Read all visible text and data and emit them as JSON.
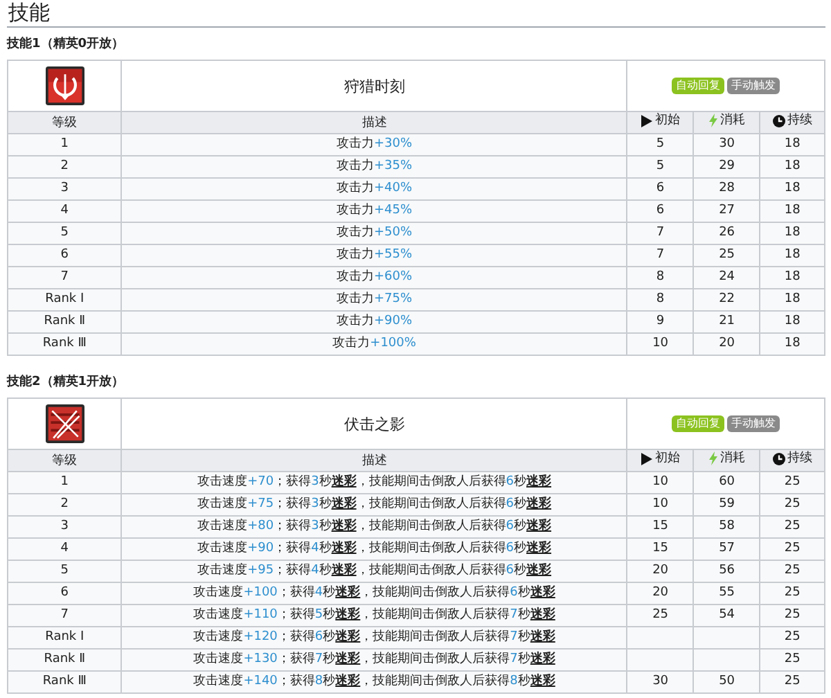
{
  "title": "技能",
  "skills": [
    {
      "heading": "技能1（精英0开放）",
      "kind": "circle-arrow",
      "name": "狩猎时刻",
      "tags": [
        {
          "label": "自动回复",
          "color": "#8cc21f"
        },
        {
          "label": "手动触发",
          "color": "#8a8a8a"
        }
      ],
      "columns": {
        "level": "等级",
        "description": "描述",
        "initial": "初始",
        "cost": "消耗",
        "duration": "持续"
      },
      "rows": [
        {
          "level": "1",
          "description": [
            {
              "kind": "plain",
              "text": "攻击力"
            },
            {
              "kind": "value",
              "text": "+30%"
            }
          ],
          "initial": "5",
          "cost": "30",
          "duration": "18"
        },
        {
          "level": "2",
          "description": [
            {
              "kind": "plain",
              "text": "攻击力"
            },
            {
              "kind": "value",
              "text": "+35%"
            }
          ],
          "initial": "5",
          "cost": "29",
          "duration": "18"
        },
        {
          "level": "3",
          "description": [
            {
              "kind": "plain",
              "text": "攻击力"
            },
            {
              "kind": "value",
              "text": "+40%"
            }
          ],
          "initial": "6",
          "cost": "28",
          "duration": "18"
        },
        {
          "level": "4",
          "description": [
            {
              "kind": "plain",
              "text": "攻击力"
            },
            {
              "kind": "value",
              "text": "+45%"
            }
          ],
          "initial": "6",
          "cost": "27",
          "duration": "18"
        },
        {
          "level": "5",
          "description": [
            {
              "kind": "plain",
              "text": "攻击力"
            },
            {
              "kind": "value",
              "text": "+50%"
            }
          ],
          "initial": "7",
          "cost": "26",
          "duration": "18"
        },
        {
          "level": "6",
          "description": [
            {
              "kind": "plain",
              "text": "攻击力"
            },
            {
              "kind": "value",
              "text": "+55%"
            }
          ],
          "initial": "7",
          "cost": "25",
          "duration": "18"
        },
        {
          "level": "7",
          "description": [
            {
              "kind": "plain",
              "text": "攻击力"
            },
            {
              "kind": "value",
              "text": "+60%"
            }
          ],
          "initial": "8",
          "cost": "24",
          "duration": "18"
        },
        {
          "level": "Rank Ⅰ",
          "description": [
            {
              "kind": "plain",
              "text": "攻击力"
            },
            {
              "kind": "value",
              "text": "+75%"
            }
          ],
          "initial": "8",
          "cost": "22",
          "duration": "18"
        },
        {
          "level": "Rank Ⅱ",
          "description": [
            {
              "kind": "plain",
              "text": "攻击力"
            },
            {
              "kind": "value",
              "text": "+90%"
            }
          ],
          "initial": "9",
          "cost": "21",
          "duration": "18"
        },
        {
          "level": "Rank Ⅲ",
          "description": [
            {
              "kind": "plain",
              "text": "攻击力"
            },
            {
              "kind": "value",
              "text": "+100%"
            }
          ],
          "initial": "10",
          "cost": "20",
          "duration": "18"
        }
      ]
    },
    {
      "heading": "技能2（精英1开放）",
      "kind": "crossed-arrows",
      "name": "伏击之影",
      "tags": [
        {
          "label": "自动回复",
          "color": "#8cc21f"
        },
        {
          "label": "手动触发",
          "color": "#8a8a8a"
        }
      ],
      "columns": {
        "level": "等级",
        "description": "描述",
        "initial": "初始",
        "cost": "消耗",
        "duration": "持续"
      },
      "rows": [
        {
          "level": "1",
          "description": [
            {
              "kind": "plain",
              "text": "攻击速度"
            },
            {
              "kind": "value",
              "text": "+70"
            },
            {
              "kind": "plain",
              "text": "；获得"
            },
            {
              "kind": "value",
              "text": "3"
            },
            {
              "kind": "plain",
              "text": "秒"
            },
            {
              "kind": "term",
              "text": "迷彩"
            },
            {
              "kind": "plain",
              "text": "，技能期间击倒敌人后获得"
            },
            {
              "kind": "value",
              "text": "6"
            },
            {
              "kind": "plain",
              "text": "秒"
            },
            {
              "kind": "term",
              "text": "迷彩"
            }
          ],
          "initial": "10",
          "cost": "60",
          "duration": "25"
        },
        {
          "level": "2",
          "description": [
            {
              "kind": "plain",
              "text": "攻击速度"
            },
            {
              "kind": "value",
              "text": "+75"
            },
            {
              "kind": "plain",
              "text": "；获得"
            },
            {
              "kind": "value",
              "text": "3"
            },
            {
              "kind": "plain",
              "text": "秒"
            },
            {
              "kind": "term",
              "text": "迷彩"
            },
            {
              "kind": "plain",
              "text": "，技能期间击倒敌人后获得"
            },
            {
              "kind": "value",
              "text": "6"
            },
            {
              "kind": "plain",
              "text": "秒"
            },
            {
              "kind": "term",
              "text": "迷彩"
            }
          ],
          "initial": "10",
          "cost": "59",
          "duration": "25"
        },
        {
          "level": "3",
          "description": [
            {
              "kind": "plain",
              "text": "攻击速度"
            },
            {
              "kind": "value",
              "text": "+80"
            },
            {
              "kind": "plain",
              "text": "；获得"
            },
            {
              "kind": "value",
              "text": "3"
            },
            {
              "kind": "plain",
              "text": "秒"
            },
            {
              "kind": "term",
              "text": "迷彩"
            },
            {
              "kind": "plain",
              "text": "，技能期间击倒敌人后获得"
            },
            {
              "kind": "value",
              "text": "6"
            },
            {
              "kind": "plain",
              "text": "秒"
            },
            {
              "kind": "term",
              "text": "迷彩"
            }
          ],
          "initial": "15",
          "cost": "58",
          "duration": "25"
        },
        {
          "level": "4",
          "description": [
            {
              "kind": "plain",
              "text": "攻击速度"
            },
            {
              "kind": "value",
              "text": "+90"
            },
            {
              "kind": "plain",
              "text": "；获得"
            },
            {
              "kind": "value",
              "text": "4"
            },
            {
              "kind": "plain",
              "text": "秒"
            },
            {
              "kind": "term",
              "text": "迷彩"
            },
            {
              "kind": "plain",
              "text": "，技能期间击倒敌人后获得"
            },
            {
              "kind": "value",
              "text": "6"
            },
            {
              "kind": "plain",
              "text": "秒"
            },
            {
              "kind": "term",
              "text": "迷彩"
            }
          ],
          "initial": "15",
          "cost": "57",
          "duration": "25"
        },
        {
          "level": "5",
          "description": [
            {
              "kind": "plain",
              "text": "攻击速度"
            },
            {
              "kind": "value",
              "text": "+95"
            },
            {
              "kind": "plain",
              "text": "；获得"
            },
            {
              "kind": "value",
              "text": "4"
            },
            {
              "kind": "plain",
              "text": "秒"
            },
            {
              "kind": "term",
              "text": "迷彩"
            },
            {
              "kind": "plain",
              "text": "，技能期间击倒敌人后获得"
            },
            {
              "kind": "value",
              "text": "6"
            },
            {
              "kind": "plain",
              "text": "秒"
            },
            {
              "kind": "term",
              "text": "迷彩"
            }
          ],
          "initial": "20",
          "cost": "56",
          "duration": "25"
        },
        {
          "level": "6",
          "description": [
            {
              "kind": "plain",
              "text": "攻击速度"
            },
            {
              "kind": "value",
              "text": "+100"
            },
            {
              "kind": "plain",
              "text": "；获得"
            },
            {
              "kind": "value",
              "text": "4"
            },
            {
              "kind": "plain",
              "text": "秒"
            },
            {
              "kind": "term",
              "text": "迷彩"
            },
            {
              "kind": "plain",
              "text": "，技能期间击倒敌人后获得"
            },
            {
              "kind": "value",
              "text": "6"
            },
            {
              "kind": "plain",
              "text": "秒"
            },
            {
              "kind": "term",
              "text": "迷彩"
            }
          ],
          "initial": "20",
          "cost": "55",
          "duration": "25"
        },
        {
          "level": "7",
          "description": [
            {
              "kind": "plain",
              "text": "攻击速度"
            },
            {
              "kind": "value",
              "text": "+110"
            },
            {
              "kind": "plain",
              "text": "；获得"
            },
            {
              "kind": "value",
              "text": "5"
            },
            {
              "kind": "plain",
              "text": "秒"
            },
            {
              "kind": "term",
              "text": "迷彩"
            },
            {
              "kind": "plain",
              "text": "，技能期间击倒敌人后获得"
            },
            {
              "kind": "value",
              "text": "7"
            },
            {
              "kind": "plain",
              "text": "秒"
            },
            {
              "kind": "term",
              "text": "迷彩"
            }
          ],
          "initial": "25",
          "cost": "54",
          "duration": "25"
        },
        {
          "level": "Rank Ⅰ",
          "description": [
            {
              "kind": "plain",
              "text": "攻击速度"
            },
            {
              "kind": "value",
              "text": "+120"
            },
            {
              "kind": "plain",
              "text": "；获得"
            },
            {
              "kind": "value",
              "text": "6"
            },
            {
              "kind": "plain",
              "text": "秒"
            },
            {
              "kind": "term",
              "text": "迷彩"
            },
            {
              "kind": "plain",
              "text": "，技能期间击倒敌人后获得"
            },
            {
              "kind": "value",
              "text": "7"
            },
            {
              "kind": "plain",
              "text": "秒"
            },
            {
              "kind": "term",
              "text": "迷彩"
            }
          ],
          "duration": "25"
        },
        {
          "level": "Rank Ⅱ",
          "description": [
            {
              "kind": "plain",
              "text": "攻击速度"
            },
            {
              "kind": "value",
              "text": "+130"
            },
            {
              "kind": "plain",
              "text": "；获得"
            },
            {
              "kind": "value",
              "text": "7"
            },
            {
              "kind": "plain",
              "text": "秒"
            },
            {
              "kind": "term",
              "text": "迷彩"
            },
            {
              "kind": "plain",
              "text": "，技能期间击倒敌人后获得"
            },
            {
              "kind": "value",
              "text": "7"
            },
            {
              "kind": "plain",
              "text": "秒"
            },
            {
              "kind": "term",
              "text": "迷彩"
            }
          ],
          "duration": "25"
        },
        {
          "level": "Rank Ⅲ",
          "description": [
            {
              "kind": "plain",
              "text": "攻击速度"
            },
            {
              "kind": "value",
              "text": "+140"
            },
            {
              "kind": "plain",
              "text": "；获得"
            },
            {
              "kind": "value",
              "text": "8"
            },
            {
              "kind": "plain",
              "text": "秒"
            },
            {
              "kind": "term",
              "text": "迷彩"
            },
            {
              "kind": "plain",
              "text": "，技能期间击倒敌人后获得"
            },
            {
              "kind": "value",
              "text": "8"
            },
            {
              "kind": "plain",
              "text": "秒"
            },
            {
              "kind": "term",
              "text": "迷彩"
            }
          ],
          "initial": "30",
          "cost": "50",
          "duration": "25"
        }
      ]
    }
  ]
}
